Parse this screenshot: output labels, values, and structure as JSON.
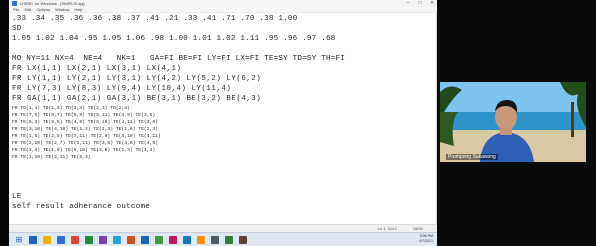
{
  "window": {
    "title": "LISREL for Windows - [SIMPLIS.spj]",
    "menu": [
      "File",
      "Edit",
      "Options",
      "Window",
      "Help"
    ],
    "controls": {
      "minimize": "–",
      "maximize": "□",
      "close": "✕"
    }
  },
  "editor": {
    "lines": [
      ".33 .34 .35 .36 .36 .38 .37 .41 .21 .33 .41 .71 .70 .38 1.00",
      "SD",
      "1.05 1.02 1.04 .95 1.05 1.06 .98 1.00 1.01 1.02 1.11 .95 .96 .97 .68",
      "",
      "MO NY=11 NX=4  NE=4   NK=1   GA=FI BE=FI LY=FI LX=FI TE=SY TD=SY TH=FI",
      "FR LX(1,1) LX(2,1) LX(3,1) LX(4,1)",
      "FR LY(1,1) LY(2,1) LY(3,1) LY(4,2) LY(5,2) LY(6,2)",
      "FR LY(7,3) LY(8,3) LY(9,4) LY(10,4) LY(11,4)",
      "FR GA(1,1) GA(2,1) GA(3,1) BE(3,1) BE(3,2) BE(4,3)",
      "FR TD(1,4) TD(1,3) TD(3,4) TD(2,3) TD(2,4)",
      "FR TE(7,5) TE(6,7) TE(5,9) TE(5,11) TE(4,9) TE(3,5)",
      "FR TE(8,3) TE(8,5) TE(4,9) TE(5,10) TE(4,11) TE(3,6)",
      "FR TE(3,10) TE(4,10) TE(1,4) TE(2,3) TE(1,6) TE(2,3)",
      "FR TE(1,5) TE(2,5) TE(7,11) TE(2,6) TE(4,10) TE(4,11)",
      "FR TE(2,10) TE(2,7) TE(1,11) TE(3,5) TE(4,6) TE(4,9)",
      "FR TE(3,4) TE(1,8) TE(6,10) TE(3,8) TE(1,3) TE(1,4)",
      "FR TE(1,10) TE(2,11) TE(5,3)",
      "",
      "",
      "",
      "LE",
      "self result adherance outcome"
    ]
  },
  "statusbar": {
    "position": "Ln 1, Col 1",
    "zoom": "100%"
  },
  "taskbar": {
    "start_glyph": "⊞",
    "tray_time": "3:06 PM",
    "tray_date": "4/7/2021",
    "icon_colors": [
      "#1d5fbf",
      "#f2b300",
      "#2b6fd6",
      "#e0452b",
      "#1f8f3a",
      "#7a3fb0",
      "#2aa0d8",
      "#d14d1c",
      "#1565c0",
      "#3b9c3f",
      "#c2185b",
      "#0f7bbf",
      "#ff8f00",
      "#455a64",
      "#2e7d32",
      "#5d4037"
    ]
  },
  "video": {
    "participant_name": "Prompong Sukawong"
  }
}
